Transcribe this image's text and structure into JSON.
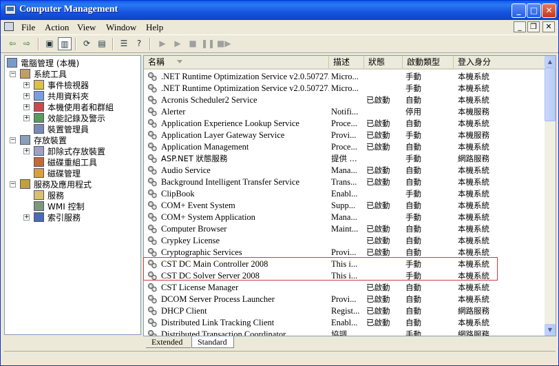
{
  "window": {
    "title": "Computer Management",
    "btn_minimize": "_",
    "btn_maximize": "□",
    "btn_close": "✕"
  },
  "menu": [
    "File",
    "Action",
    "View",
    "Window",
    "Help"
  ],
  "mdi_controls": [
    "_",
    "❐",
    "✕"
  ],
  "tree": [
    {
      "label": "電腦管理 (本機)",
      "level": 0,
      "expander": ""
    },
    {
      "label": "系統工具",
      "level": 1,
      "expander": "−"
    },
    {
      "label": "事件檢視器",
      "level": 2,
      "expander": "+"
    },
    {
      "label": "共用資料夾",
      "level": 2,
      "expander": "+"
    },
    {
      "label": "本機使用者和群組",
      "level": 2,
      "expander": "+"
    },
    {
      "label": "效能記錄及警示",
      "level": 2,
      "expander": "+"
    },
    {
      "label": "裝置管理員",
      "level": 2,
      "expander": ""
    },
    {
      "label": "存放裝置",
      "level": 1,
      "expander": "−"
    },
    {
      "label": "卸除式存放裝置",
      "level": 2,
      "expander": "+"
    },
    {
      "label": "磁碟重組工具",
      "level": 2,
      "expander": ""
    },
    {
      "label": "磁碟管理",
      "level": 2,
      "expander": ""
    },
    {
      "label": "服務及應用程式",
      "level": 1,
      "expander": "−"
    },
    {
      "label": "服務",
      "level": 2,
      "expander": ""
    },
    {
      "label": "WMI 控制",
      "level": 2,
      "expander": ""
    },
    {
      "label": "索引服務",
      "level": 2,
      "expander": "+"
    }
  ],
  "columns": [
    "名稱",
    "描述",
    "狀態",
    "啟動類型",
    "登入身分"
  ],
  "services": [
    [
      ".NET Runtime Optimization Service v2.0.50727...",
      "Micro...",
      "",
      "手動",
      "本機系統"
    ],
    [
      ".NET Runtime Optimization Service v2.0.50727...",
      "Micro...",
      "",
      "手動",
      "本機系統"
    ],
    [
      "Acronis Scheduler2 Service",
      "",
      "已啟動",
      "自動",
      "本機系統"
    ],
    [
      "Alerter",
      "Notifi...",
      "",
      "停用",
      "本機服務"
    ],
    [
      "Application Experience Lookup Service",
      "Proce...",
      "已啟動",
      "自動",
      "本機系統"
    ],
    [
      "Application Layer Gateway Service",
      "Provi...",
      "已啟動",
      "手動",
      "本機服務"
    ],
    [
      "Application Management",
      "Proce...",
      "已啟動",
      "自動",
      "本機系統"
    ],
    [
      "ASP.NET 狀態服務",
      "提供 ...",
      "",
      "手動",
      "網路服務"
    ],
    [
      "Audio Service",
      "Mana...",
      "已啟動",
      "自動",
      "本機系統"
    ],
    [
      "Background Intelligent Transfer Service",
      "Trans...",
      "已啟動",
      "自動",
      "本機系統"
    ],
    [
      "ClipBook",
      "Enabl...",
      "",
      "手動",
      "本機系統"
    ],
    [
      "COM+ Event System",
      "Supp...",
      "已啟動",
      "自動",
      "本機系統"
    ],
    [
      "COM+ System Application",
      "Mana...",
      "",
      "手動",
      "本機系統"
    ],
    [
      "Computer Browser",
      "Maint...",
      "已啟動",
      "自動",
      "本機系統"
    ],
    [
      "Crypkey License",
      "",
      "已啟動",
      "自動",
      "本機系統"
    ],
    [
      "Cryptographic Services",
      "Provi...",
      "已啟動",
      "自動",
      "本機系統"
    ],
    [
      "CST DC Main Controller 2008",
      "This i...",
      "",
      "手動",
      "本機系統"
    ],
    [
      "CST DC Solver Server 2008",
      "This i...",
      "",
      "手動",
      "本機系統"
    ],
    [
      "CST License Manager",
      "",
      "已啟動",
      "自動",
      "本機系統"
    ],
    [
      "DCOM Server Process Launcher",
      "Provi...",
      "已啟動",
      "自動",
      "本機系統"
    ],
    [
      "DHCP Client",
      "Regist...",
      "已啟動",
      "自動",
      "網路服務"
    ],
    [
      "Distributed Link Tracking Client",
      "Enabl...",
      "已啟動",
      "自動",
      "本機系統"
    ],
    [
      "Distributed Transaction Coordinator",
      "協調 ...",
      "",
      "手動",
      "網路服務"
    ]
  ],
  "tabs": [
    "Extended",
    "Standard"
  ],
  "active_tab": "Standard",
  "colors": {
    "title_blue": "#0a5ee8",
    "highlight_red": "#d43a3a"
  }
}
